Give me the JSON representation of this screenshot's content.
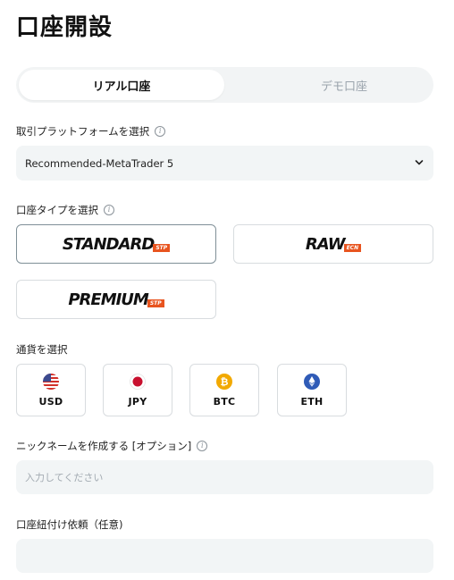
{
  "page_title": "口座開設",
  "account_toggle": {
    "live": "リアル口座",
    "demo": "デモ口座"
  },
  "platform": {
    "label": "取引プラットフォームを選択",
    "selected": "Recommended-MetaTrader 5"
  },
  "account_type": {
    "label": "口座タイプを選択",
    "types": [
      {
        "name": "STANDARD",
        "badge": "STP"
      },
      {
        "name": "RAW",
        "badge": "ECN"
      },
      {
        "name": "PREMIUM",
        "badge": "STP"
      }
    ]
  },
  "currency": {
    "label": "通貨を選択",
    "options": [
      {
        "code": "USD",
        "icon": "us-flag-icon"
      },
      {
        "code": "JPY",
        "icon": "japan-flag-icon"
      },
      {
        "code": "BTC",
        "icon": "bitcoin-icon"
      },
      {
        "code": "ETH",
        "icon": "ethereum-icon"
      }
    ]
  },
  "nickname": {
    "label": "ニックネームを作成する [オプション]",
    "placeholder": "入力してください"
  },
  "account_link": {
    "label": "口座紐付け依頼（任意)"
  },
  "colors": {
    "accent_badge": "#e8541f",
    "field_bg": "#f2f5f6"
  }
}
